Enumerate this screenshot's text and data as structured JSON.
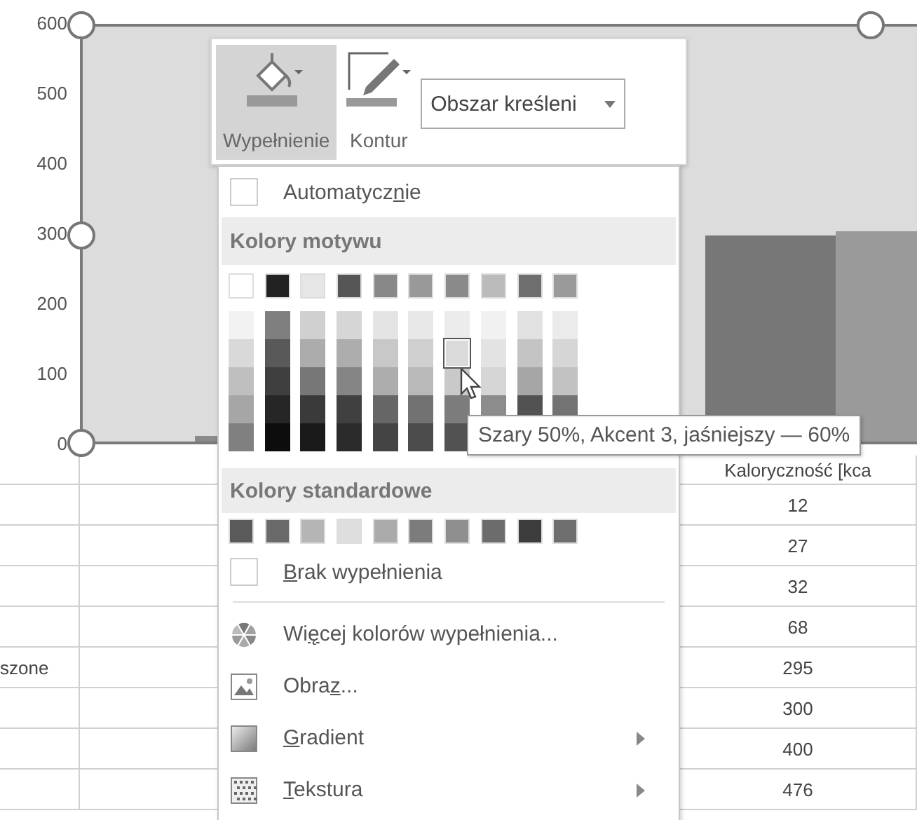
{
  "chart": {
    "axis_labels": [
      "600",
      "500",
      "400",
      "300",
      "200",
      "100",
      "0"
    ]
  },
  "sheet": {
    "header": "Kaloryczność [kca",
    "rows": [
      {
        "value": "12"
      },
      {
        "value": "27"
      },
      {
        "value": "32"
      },
      {
        "value": "68"
      },
      {
        "label": "szone",
        "value": "295"
      },
      {
        "value": "300"
      },
      {
        "value": "400"
      },
      {
        "value": "476"
      }
    ]
  },
  "toolbar": {
    "buttons": [
      {
        "kind": "fill",
        "label": "Wypełnienie",
        "selected": true
      },
      {
        "kind": "outline",
        "label": "Kontur",
        "selected": false
      }
    ],
    "dropdown": "Obszar kreśleni"
  },
  "menu": {
    "automatic": {
      "before": "Automatycz",
      "key": "n",
      "after": "ie"
    },
    "theme_header": "Kolory motywu",
    "theme_colors": [
      {
        "color": "#ffffff",
        "shades": [
          {
            "color": "#f2f2f2",
            "selected": false
          },
          {
            "color": "#d9d9d9",
            "selected": false
          },
          {
            "color": "#bfbfbf",
            "selected": false
          },
          {
            "color": "#a6a6a6",
            "selected": false
          },
          {
            "color": "#808080",
            "selected": false
          }
        ]
      },
      {
        "color": "#222222",
        "shades": [
          {
            "color": "#7f7f7f",
            "selected": false
          },
          {
            "color": "#595959",
            "selected": false
          },
          {
            "color": "#3f3f3f",
            "selected": false
          },
          {
            "color": "#262626",
            "selected": false
          },
          {
            "color": "#0d0d0d",
            "selected": false
          }
        ]
      },
      {
        "color": "#e6e6e6",
        "shades": [
          {
            "color": "#d0d0d0",
            "selected": false
          },
          {
            "color": "#acacac",
            "selected": false
          },
          {
            "color": "#777777",
            "selected": false
          },
          {
            "color": "#3a3a3a",
            "selected": false
          },
          {
            "color": "#1a1a1a",
            "selected": false
          }
        ]
      },
      {
        "color": "#555555",
        "shades": [
          {
            "color": "#d6d6d6",
            "selected": false
          },
          {
            "color": "#adadad",
            "selected": false
          },
          {
            "color": "#858585",
            "selected": false
          },
          {
            "color": "#404040",
            "selected": false
          },
          {
            "color": "#2b2b2b",
            "selected": false
          }
        ]
      },
      {
        "color": "#888888",
        "shades": [
          {
            "color": "#e4e4e4",
            "selected": false
          },
          {
            "color": "#c8c8c8",
            "selected": false
          },
          {
            "color": "#adadad",
            "selected": false
          },
          {
            "color": "#666666",
            "selected": false
          },
          {
            "color": "#444444",
            "selected": false
          }
        ]
      },
      {
        "color": "#999999",
        "shades": [
          {
            "color": "#e8e8e8",
            "selected": false
          },
          {
            "color": "#d0d0d0",
            "selected": false
          },
          {
            "color": "#b9b9b9",
            "selected": false
          },
          {
            "color": "#727272",
            "selected": false
          },
          {
            "color": "#4c4c4c",
            "selected": false
          }
        ]
      },
      {
        "color": "#8a8a8a",
        "shades": [
          {
            "color": "#ececec",
            "selected": false
          },
          {
            "color": "#dbdbdb",
            "selected": true
          },
          {
            "color": "#c9c9c9",
            "selected": false
          },
          {
            "color": "#7c7c7c",
            "selected": false
          },
          {
            "color": "#525252",
            "selected": false
          }
        ]
      },
      {
        "color": "#bbbbbb",
        "shades": [
          {
            "color": "#f1f1f1",
            "selected": false
          },
          {
            "color": "#e3e3e3",
            "selected": false
          },
          {
            "color": "#d6d6d6",
            "selected": false
          },
          {
            "color": "#8c8c8c",
            "selected": false
          }
        ]
      },
      {
        "color": "#6e6e6e",
        "shades": [
          {
            "color": "#e1e1e1",
            "selected": false
          },
          {
            "color": "#c4c4c4",
            "selected": false
          },
          {
            "color": "#a6a6a6",
            "selected": false
          },
          {
            "color": "#525252",
            "selected": false
          }
        ]
      },
      {
        "color": "#9a9a9a",
        "shades": [
          {
            "color": "#ebebeb",
            "selected": false
          },
          {
            "color": "#d6d6d6",
            "selected": false
          },
          {
            "color": "#c2c2c2",
            "selected": false
          },
          {
            "color": "#737373",
            "selected": false
          }
        ]
      }
    ],
    "standard_header": "Kolory standardowe",
    "standard_colors": [
      {
        "color": "#5a5a5a"
      },
      {
        "color": "#6a6a6a"
      },
      {
        "color": "#b5b5b5"
      },
      {
        "color": "#dedede"
      },
      {
        "color": "#ababab"
      },
      {
        "color": "#7c7c7c"
      },
      {
        "color": "#8f8f8f"
      },
      {
        "color": "#6c6c6c"
      },
      {
        "color": "#3c3c3c"
      },
      {
        "color": "#6e6e6e"
      }
    ],
    "no_fill": {
      "key": "B",
      "after": "rak wypełnienia"
    },
    "items": [
      {
        "kind": "more_colors",
        "label": {
          "before": "Wi",
          "key": "ę",
          "after": "cej kolorów wypełnienia..."
        },
        "submenu": false
      },
      {
        "kind": "picture",
        "label": {
          "before": "Obra",
          "key": "z",
          "after": "..."
        },
        "submenu": false
      },
      {
        "kind": "gradient",
        "label": {
          "key": "G",
          "after": "radient"
        },
        "submenu": true
      },
      {
        "kind": "texture",
        "label": {
          "key": "T",
          "after": "ekstura"
        },
        "submenu": true
      }
    ]
  },
  "tooltip": "Szary 50%, Akcent 3, jaśniejszy — 60%"
}
